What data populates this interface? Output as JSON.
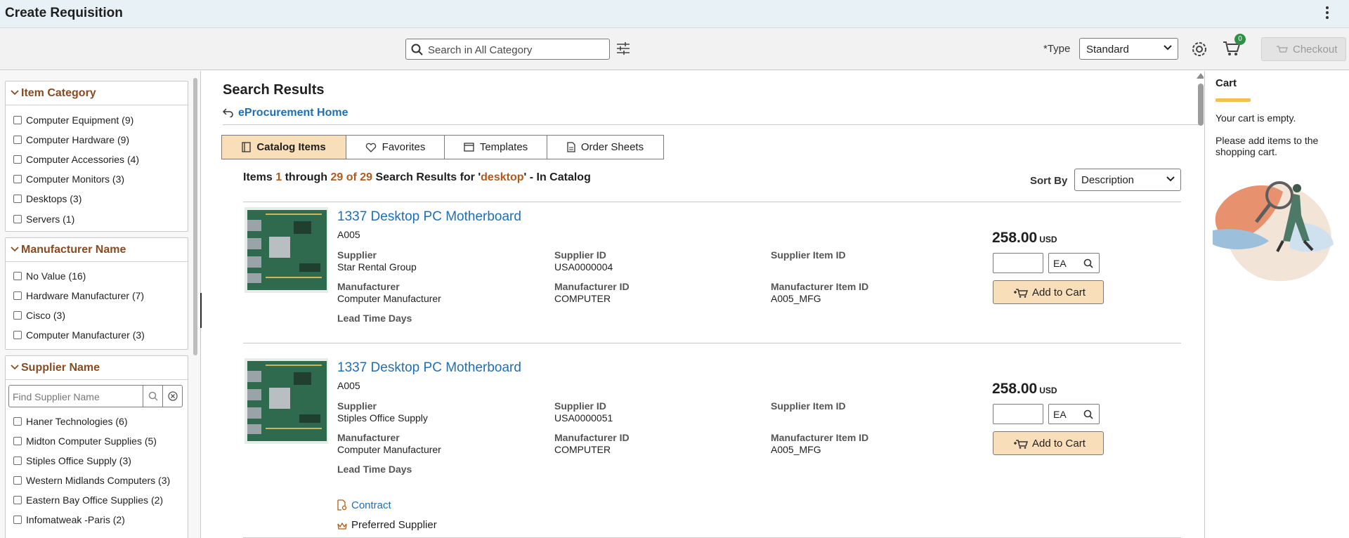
{
  "header": {
    "title": "Create Requisition"
  },
  "toolbar": {
    "search_placeholder": "Search in All Category",
    "type_label": "*Type",
    "type_value": "Standard",
    "cart_count": "0",
    "checkout_label": "Checkout"
  },
  "facets": {
    "item_category": {
      "title": "Item Category",
      "items": [
        "Computer Equipment (9)",
        "Computer Hardware (9)",
        "Computer Accessories (4)",
        "Computer Monitors (3)",
        "Desktops (3)",
        "Servers (1)"
      ]
    },
    "manufacturer": {
      "title": "Manufacturer Name",
      "items": [
        "No Value (16)",
        "Hardware Manufacturer (7)",
        "Cisco (3)",
        "Computer Manufacturer (3)"
      ]
    },
    "supplier": {
      "title": "Supplier Name",
      "search_placeholder": "Find Supplier Name",
      "items": [
        "Haner Technologies (6)",
        "Midton Computer Supplies (5)",
        "Stiples Office Supply (3)",
        "Western Midlands Computers (3)",
        "Eastern Bay Office Supplies (2)",
        "Infomatweak -Paris (2)"
      ]
    }
  },
  "main": {
    "title": "Search Results",
    "home_link": "eProcurement Home",
    "tabs": [
      {
        "label": "Catalog Items",
        "icon": "book-icon"
      },
      {
        "label": "Favorites",
        "icon": "heart-icon"
      },
      {
        "label": "Templates",
        "icon": "template-icon"
      },
      {
        "label": "Order Sheets",
        "icon": "document-icon"
      }
    ],
    "results_summary": {
      "prefix": "Items ",
      "from": "1",
      "through_word": " through ",
      "to_of": "29 of 29",
      "mid": " Search Results for '",
      "query": "desktop",
      "suffix": "' - In Catalog"
    },
    "sort_label": "Sort By",
    "sort_value": "Description",
    "labels": {
      "supplier": "Supplier",
      "supplier_id": "Supplier ID",
      "supplier_item_id": "Supplier Item ID",
      "manufacturer": "Manufacturer",
      "manufacturer_id": "Manufacturer ID",
      "manufacturer_item_id": "Manufacturer Item ID",
      "lead_time": "Lead Time Days",
      "currency": "USD",
      "add_to_cart": "Add to Cart"
    },
    "results": [
      {
        "name": "1337 Desktop PC Motherboard",
        "code": "A005",
        "supplier": "Star Rental Group",
        "supplier_id": "USA0000004",
        "supplier_item_id": "",
        "manufacturer": "Computer Manufacturer",
        "manufacturer_id": "COMPUTER",
        "manufacturer_item_id": "A005_MFG",
        "price": "258.00",
        "uom": "EA"
      },
      {
        "name": "1337 Desktop PC Motherboard",
        "code": "A005",
        "supplier": "Stiples Office Supply",
        "supplier_id": "USA0000051",
        "supplier_item_id": "",
        "manufacturer": "Computer Manufacturer",
        "manufacturer_id": "COMPUTER",
        "manufacturer_item_id": "A005_MFG",
        "price": "258.00",
        "uom": "EA",
        "contract_link": "Contract",
        "preferred_label": "Preferred Supplier"
      }
    ]
  },
  "cart": {
    "title": "Cart",
    "empty_message": "Your cart is empty.",
    "add_message": "Please add items to the shopping cart."
  },
  "colors": {
    "accent": "#8a4a1f",
    "link": "#1f6fb5",
    "button_bg": "#f8deb9",
    "cart_bar": "#f2c14e"
  }
}
